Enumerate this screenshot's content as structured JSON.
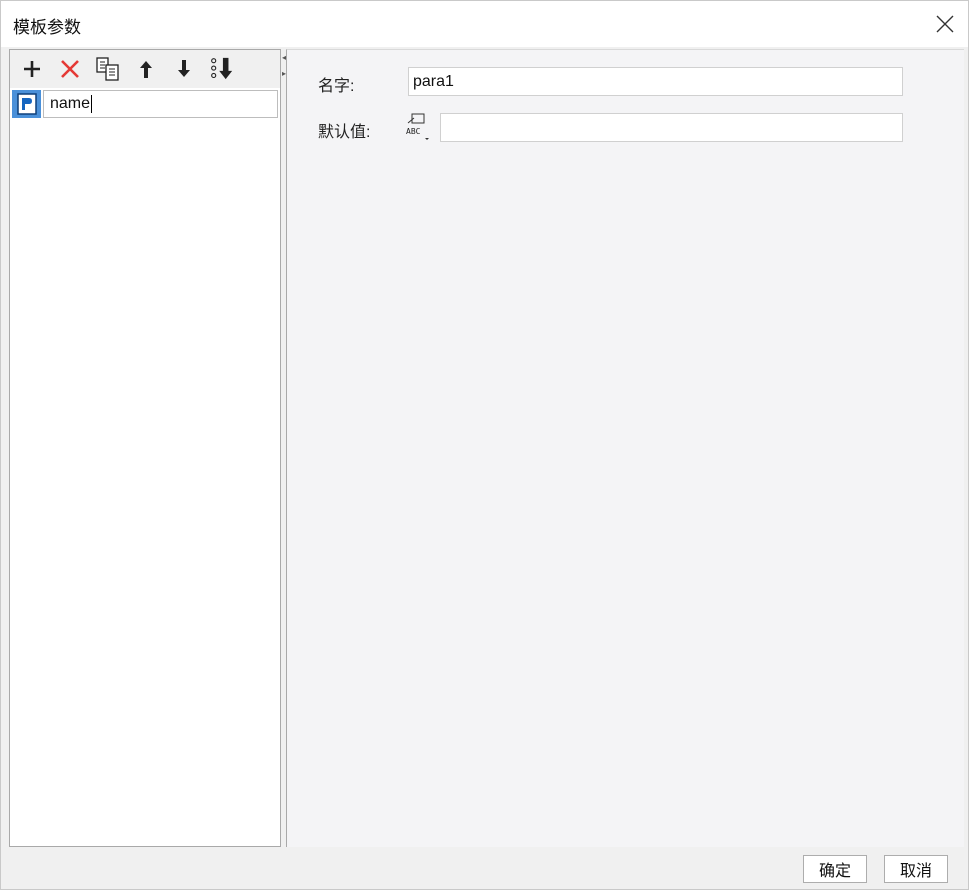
{
  "window": {
    "title": "模板参数"
  },
  "toolbar": {
    "buttons": [
      {
        "name": "add",
        "icon": "plus-icon"
      },
      {
        "name": "delete",
        "icon": "delete-x-icon"
      },
      {
        "name": "copy",
        "icon": "copy-icon"
      },
      {
        "name": "move-up",
        "icon": "arrow-up-icon"
      },
      {
        "name": "move-down",
        "icon": "arrow-down-icon"
      },
      {
        "name": "sort",
        "icon": "sort-icon"
      }
    ]
  },
  "params": {
    "items": [
      {
        "label": "name",
        "icon": "parameter-icon"
      }
    ]
  },
  "form": {
    "name_label": "名字:",
    "name_value": "para1",
    "default_label": "默认值:",
    "default_value": "",
    "default_type_icon": "abc-type-icon"
  },
  "footer": {
    "ok_label": "确定",
    "cancel_label": "取消"
  },
  "colors": {
    "accent": "#4a90d9",
    "delete_red": "#e53935",
    "pane_bg": "#f4f4f6"
  }
}
